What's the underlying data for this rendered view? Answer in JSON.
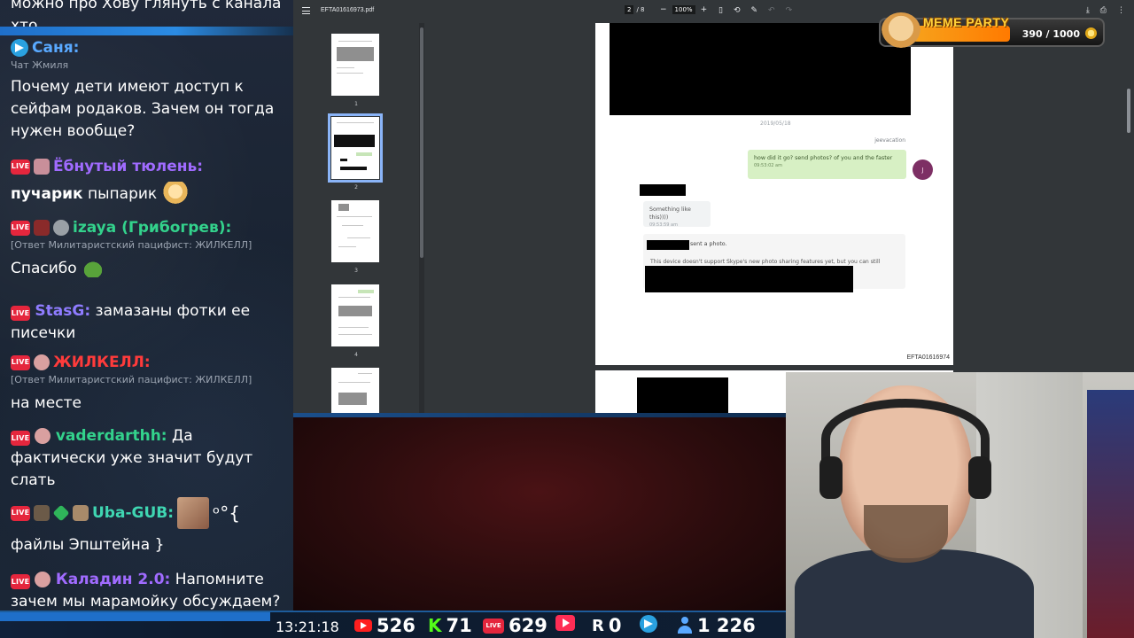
{
  "chat": {
    "top_message": "можно про Хову глянуть с канала хто",
    "messages": [
      {
        "name": "Саня:",
        "sub": "Чат Жмиля",
        "body": "Почему дети имеют доступ к сейфам родаков. Зачем он тогда нужен вообще?"
      },
      {
        "name": "Ёбнутый тюлень:",
        "body_bold": "пучарик",
        "body": " пыпарик"
      },
      {
        "name": "izaya (Грибогрев):",
        "sub": "[Ответ Милитаристский пацифист: ЖИЛКЕЛЛ]",
        "body": "Спасибо"
      },
      {
        "name": "StasG:",
        "body": "замазаны фотки ее писечки"
      },
      {
        "name": "ЖИЛКЕЛЛ:",
        "sub": "[Ответ Милитаристский пацифист: ЖИЛКЕЛЛ]",
        "body": "на месте"
      },
      {
        "name": "vaderdarthh:",
        "body": "Да фактически уже значит будут слать"
      },
      {
        "name": "Uba-GUB:",
        "body_tail": "ᵒ°{",
        "body": "файлы Эпштейна }"
      },
      {
        "name": "Каладин 2.0:",
        "body": "Напомните зачем мы марамойку обсуждаем?"
      }
    ],
    "live_label": "LIVE"
  },
  "pdf": {
    "filename": "EFTA01616973.pdf",
    "page_current": "2",
    "page_total": "/ 8",
    "zoom": "100%",
    "thumb_numbers": [
      "1",
      "2",
      "3",
      "4"
    ],
    "page": {
      "date": "2019/05/18",
      "sender": "jeevacation",
      "outgoing_text": "how did it go?  send photos? of you and the faster",
      "outgoing_time": "09:53:02 am",
      "avatar_letter": "J",
      "incoming_text": "Something like this))))",
      "incoming_time": "09:53:59 am",
      "photo_sent": "sent a photo.",
      "photo_note": "This device doesn't support Skype's new photo sharing features yet, but you can still",
      "page_id": "EFTA01616974"
    }
  },
  "meme": {
    "title": "MEME PARTY",
    "score": "390 / 1000"
  },
  "stats": {
    "clock": "13:21:18",
    "youtube": "526",
    "kick": "71",
    "vk": "629",
    "rutube_label": "R",
    "rutube": "0",
    "telegram": "1 226",
    "k_letter": "K"
  },
  "colors": {
    "chat_bg": "#1b2636",
    "accent_blue": "#1f6fc9",
    "live_red": "#e5263d",
    "pdf_bg": "#323639"
  }
}
